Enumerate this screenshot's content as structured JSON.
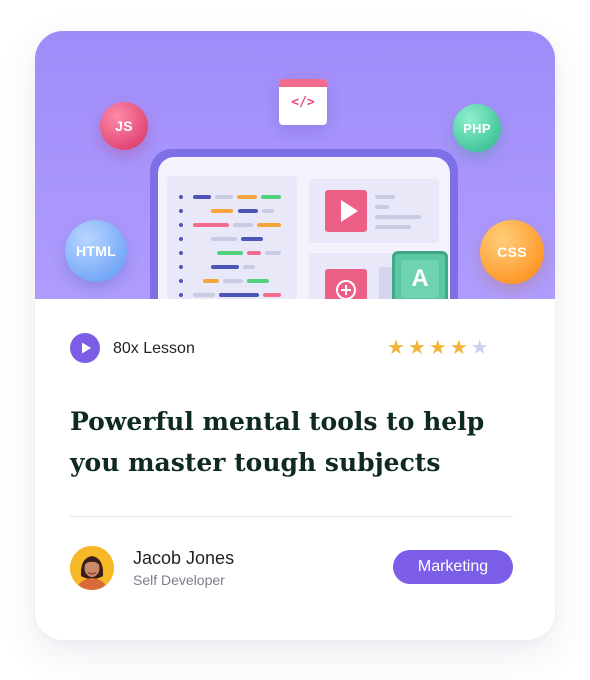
{
  "hero": {
    "bubbles": {
      "js": "JS",
      "php": "PHP",
      "html": "HTML",
      "css": "CSS"
    },
    "code_tile": "</>",
    "letter_tile": "A"
  },
  "course": {
    "lesson_count": "80x Lesson",
    "rating": {
      "value": 4,
      "max": 5
    },
    "title": "Powerful mental tools to help you master tough subjects"
  },
  "author": {
    "name": "Jacob Jones",
    "role": "Self Developer"
  },
  "category_tag": "Marketing",
  "colors": {
    "accent": "#7b5de8",
    "star": "#f2b53c",
    "star_empty": "#cdd0f2",
    "title": "#0f2a1f",
    "hero_background": "#a895fb"
  }
}
